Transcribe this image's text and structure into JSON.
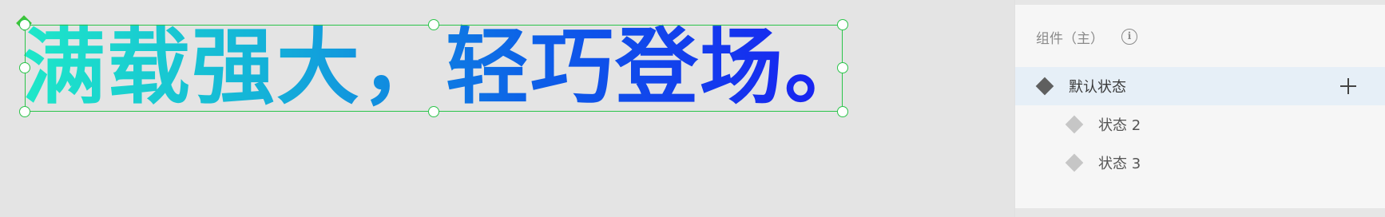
{
  "canvas": {
    "headline_text": "满载强大，轻巧登场。",
    "gradient_colors": [
      "#1ee8c8",
      "#14b4d8",
      "#0c5ee8",
      "#1a1cf2"
    ],
    "selection_color": "#2bc44a"
  },
  "panel": {
    "header_label": "组件（主）",
    "info_icon_glyph": "i",
    "states": [
      {
        "label": "默认状态",
        "selected": true
      },
      {
        "label": "状态 2",
        "selected": false
      },
      {
        "label": "状态 3",
        "selected": false
      }
    ],
    "selected_row_color": "#e6eff7"
  }
}
